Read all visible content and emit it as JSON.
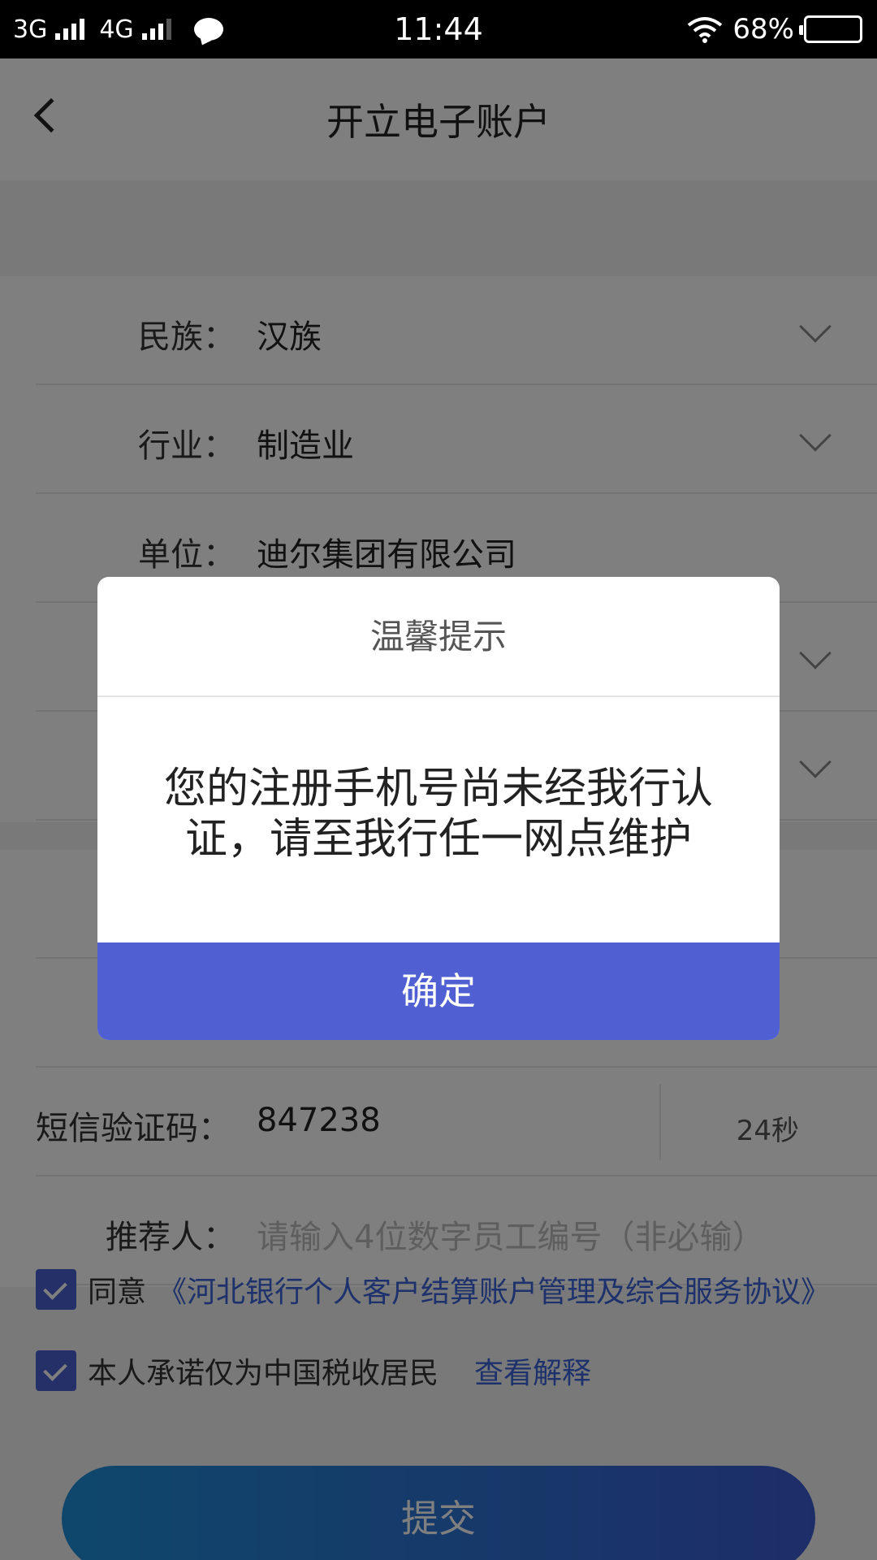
{
  "status_bar": {
    "net1": "3G",
    "net2": "4G",
    "time": "11:44",
    "battery": "68%"
  },
  "nav": {
    "title": "开立电子账户"
  },
  "form": {
    "ethnicity": {
      "label": "民族：",
      "value": "汉族"
    },
    "industry": {
      "label": "行业：",
      "value": "制造业"
    },
    "employer": {
      "label": "单位：",
      "value": "迪尔集团有限公司"
    },
    "sms_code": {
      "label": "短信验证码：",
      "value": "847238",
      "countdown": "24秒"
    },
    "referrer": {
      "label": "推荐人：",
      "placeholder": "请输入4位数字员工编号（非必输）"
    }
  },
  "agreements": {
    "agree_prefix": "同意",
    "agree_link": "《河北银行个人客户结算账户管理及综合服务协议》",
    "tax_text": "本人承诺仅为中国税收居民",
    "tax_link": "查看解释"
  },
  "submit_label": "提交",
  "dialog": {
    "title": "温馨提示",
    "message": "您的注册手机号尚未经我行认证，请至我行任一网点维护",
    "confirm_label": "确定"
  },
  "colors": {
    "accent": "#5060d3",
    "link": "#3b63d8",
    "overlay": "rgba(0,0,0,0.5)"
  }
}
